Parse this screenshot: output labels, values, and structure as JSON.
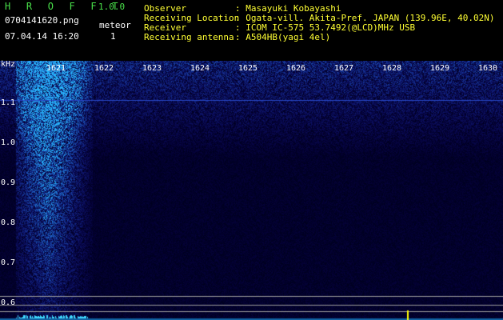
{
  "app": {
    "title": "H R O F F T",
    "version": "1.0.0"
  },
  "file": {
    "name": "0704141620.png",
    "datetime": "07.04.14 16:20"
  },
  "event": {
    "label": "meteor",
    "count": "1"
  },
  "info": {
    "observer_label": "Observer",
    "observer_value": ": Masayuki Kobayashi",
    "location_label": "Receiving Location",
    "location_value": ": Ogata-vill. Akita-Pref. JAPAN (139.96E, 40.02N)",
    "receiver_label": "Receiver",
    "receiver_value": ": ICOM IC-575 53.7492(@LCD)MHz USB",
    "antenna_label": "Receiving antenna",
    "antenna_value": ": A504HB(yagi 4el)"
  },
  "axis": {
    "unit": "kHz",
    "x_ticks": [
      "1621",
      "1622",
      "1623",
      "1624",
      "1625",
      "1626",
      "1627",
      "1628",
      "1629",
      "1630"
    ],
    "y_ticks": [
      "1.1",
      "1.0",
      "0.9",
      "0.8",
      "0.7",
      "0.6"
    ]
  },
  "colors": {
    "title_green": "#49e04a",
    "info_yellow": "#ffff33",
    "signal": "#0a3aa0",
    "marker": "#ffff00"
  }
}
